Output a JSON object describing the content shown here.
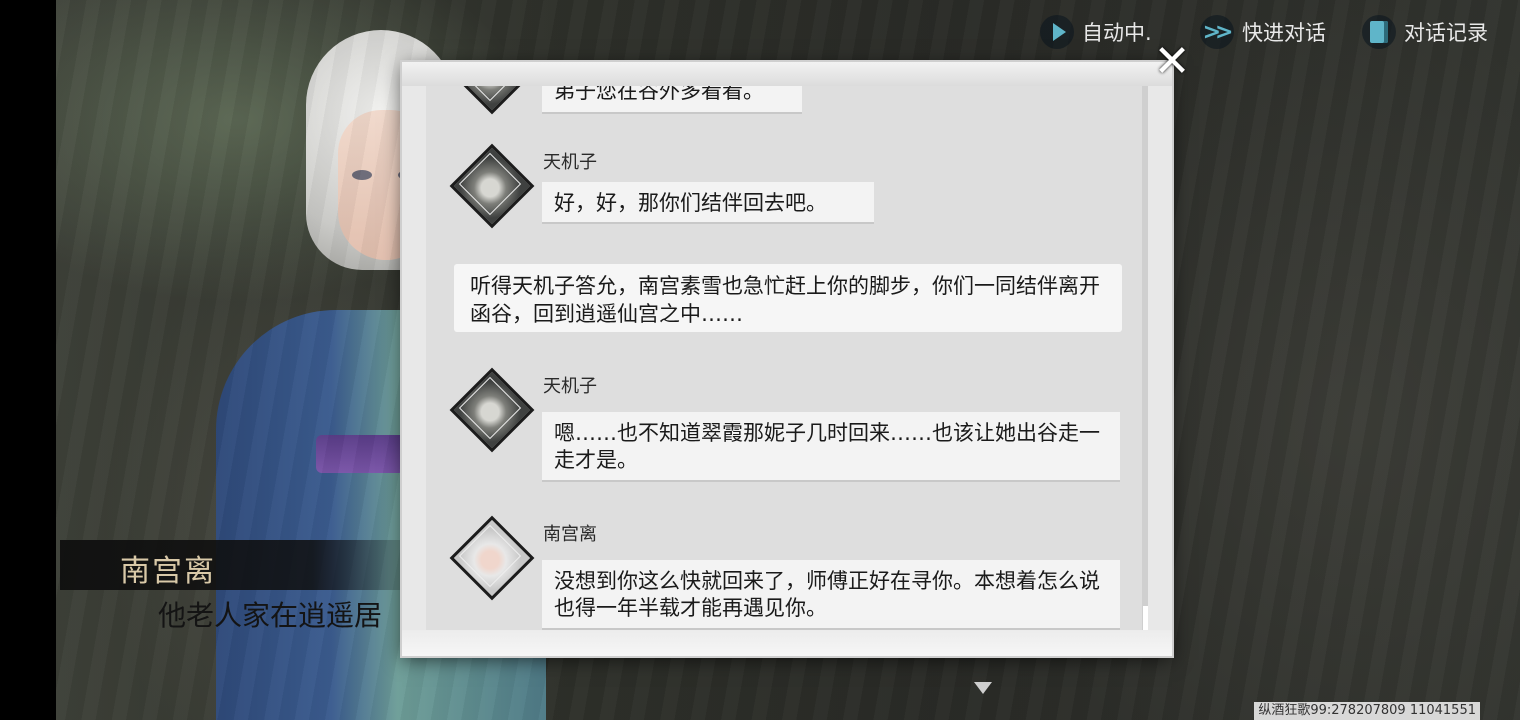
{
  "top_controls": {
    "auto_label": "自动中.",
    "skip_label": "快进对话",
    "log_label": "对话记录"
  },
  "dialogue": {
    "speaker": "南宫离",
    "line_visible": "他老人家在逍遥居"
  },
  "log": {
    "partial_top": "弟子您在谷外多看看。",
    "entries": [
      {
        "speaker": "天机子",
        "text": "好，好，那你们结伴回去吧。"
      },
      {
        "narration": "听得天机子答允，南宫素雪也急忙赶上你的脚步，你们一同结伴离开函谷，回到逍遥仙宫之中……"
      },
      {
        "speaker": "天机子",
        "text": "嗯……也不知道翠霞那妮子几时回来……也该让她出谷走一走才是。"
      },
      {
        "speaker": "南宫离",
        "text": "没想到你这么快就回来了，师傅正好在寻你。本想着怎么说也得一年半载才能再遇见你。"
      }
    ]
  },
  "close_symbol": "✕",
  "watermark": "纵酒狂歌99:278207809  11041551",
  "icons": {
    "auto": "play-icon",
    "skip": "fast-forward-icon",
    "log": "book-icon",
    "next": "down-triangle-icon"
  },
  "colors": {
    "accent": "#5fb5c9",
    "panel": "#e8e8e8",
    "name_text": "#d9c9a8"
  }
}
